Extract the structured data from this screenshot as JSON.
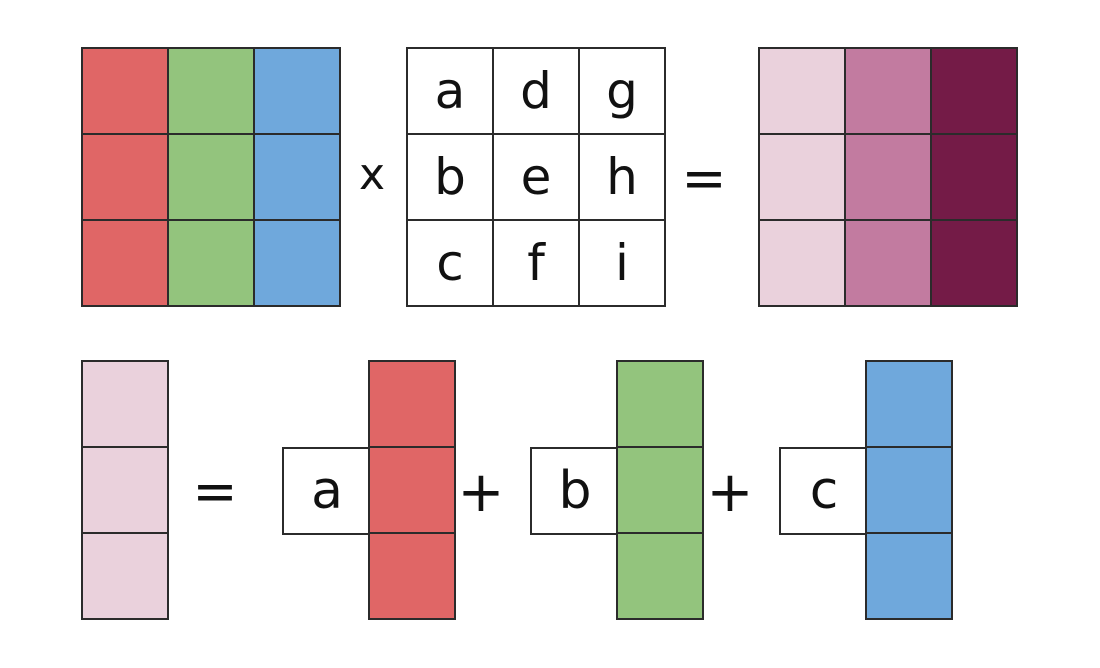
{
  "colors": {
    "red": "#e06666",
    "green": "#93c47d",
    "blue": "#6fa8dc",
    "light_pink": "#ead1dc",
    "mauve": "#c27ba0",
    "maroon": "#741b47",
    "white": "#ffffff"
  },
  "top": {
    "left_matrix": {
      "cells": [
        [
          "red",
          "green",
          "blue"
        ],
        [
          "red",
          "green",
          "blue"
        ],
        [
          "red",
          "green",
          "blue"
        ]
      ]
    },
    "times_symbol": "x",
    "coefficient_matrix": {
      "cells": [
        [
          "a",
          "d",
          "g"
        ],
        [
          "b",
          "e",
          "h"
        ],
        [
          "c",
          "f",
          "i"
        ]
      ]
    },
    "equals_symbol": "=",
    "result_matrix": {
      "cells": [
        [
          "light_pink",
          "mauve",
          "maroon"
        ],
        [
          "light_pink",
          "mauve",
          "maroon"
        ],
        [
          "light_pink",
          "mauve",
          "maroon"
        ]
      ]
    }
  },
  "bottom": {
    "result_column": {
      "color": "light_pink"
    },
    "equals_symbol": "=",
    "terms": [
      {
        "coefficient": "a",
        "color": "red"
      },
      {
        "coefficient": "b",
        "color": "green"
      },
      {
        "coefficient": "c",
        "color": "blue"
      }
    ],
    "plus_symbols": [
      "+",
      "+"
    ]
  }
}
